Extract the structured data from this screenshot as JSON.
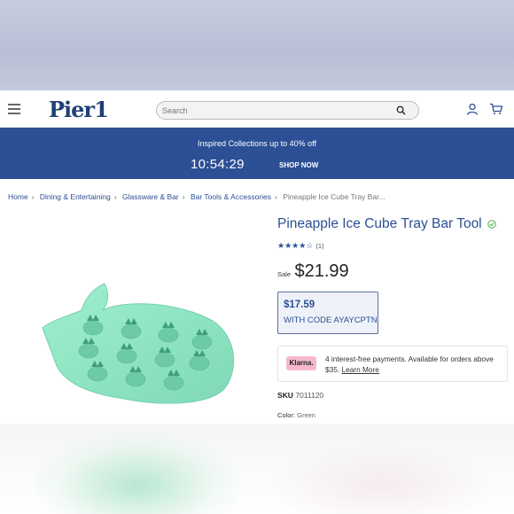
{
  "header": {
    "logo": "Pier1",
    "search_placeholder": "Search"
  },
  "promo": {
    "message": "Inspired Collections up to 40% off",
    "timer": "10:54:29",
    "cta": "SHOP NOW"
  },
  "breadcrumb": [
    "Home",
    "Dining & Entertaining",
    "Glassware & Bar",
    "Bar Tools & Accessories",
    "Pineapple Ice Cube Tray Bar..."
  ],
  "product": {
    "title": "Pineapple Ice Cube Tray Bar Tool",
    "rating_stars": "★★★★☆",
    "rating_value": 4,
    "review_count": "(1)",
    "sale_label": "Sale",
    "price": "$21.99",
    "coupon_price": "$17.59",
    "coupon_code": "WITH CODE AYAYCPTN",
    "klarna_badge": "Klarna.",
    "klarna_text": "4 interest-free payments. Available for orders above $35.",
    "klarna_link": "Learn More",
    "sku_label": "SKU",
    "sku_value": "7011120",
    "color_label": "Color:",
    "color_value": "Green"
  },
  "colors": {
    "brand_blue": "#2c4f95",
    "product_green": "#8fe3c0"
  }
}
